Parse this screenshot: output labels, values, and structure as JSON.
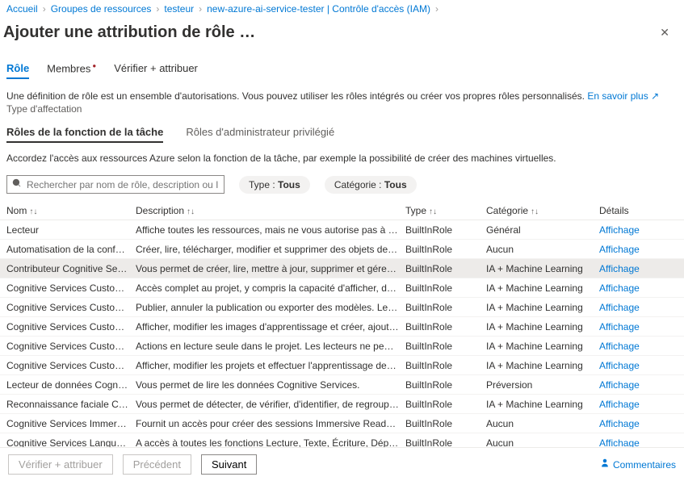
{
  "breadcrumb": [
    "Accueil",
    "Groupes de ressources",
    "testeur",
    "new-azure-ai-service-tester | Contrôle d'accès (IAM)"
  ],
  "page_title": "Ajouter une attribution de rôle",
  "title_dots": "…",
  "tabs": {
    "role": "Rôle",
    "members": "Membres",
    "review": "Vérifier + attribuer"
  },
  "definition_text": "Une définition de rôle est un ensemble d'autorisations. Vous pouvez utiliser les rôles intégrés ou créer vos propres rôles personnalisés.",
  "learn_more": "En savoir plus",
  "assignment_type_label": "Type d'affectation",
  "subtabs": {
    "job": "Rôles de la fonction de la tâche",
    "admin": "Rôles d'administrateur privilégié"
  },
  "subtab_help": "Accordez l'accès aux ressources Azure selon la fonction de la tâche, par exemple la possibilité de créer des machines virtuelles.",
  "search_placeholder": "Rechercher par nom de rôle, description ou ID",
  "filter_type": {
    "label": "Type : ",
    "value": "Tous"
  },
  "filter_cat": {
    "label": "Catégorie : ",
    "value": "Tous"
  },
  "columns": {
    "name": "Nom",
    "desc": "Description",
    "type": "Type",
    "cat": "Catégorie",
    "details": "Détails"
  },
  "view_label": "Affichage",
  "rows": [
    {
      "name": "Lecteur",
      "desc": "Affiche toutes les ressources, mais ne vous autorise pas à apporter des ch…",
      "type": "BuiltInRole",
      "cat": "Général"
    },
    {
      "name": "Automatisation de la confor…",
      "desc": "Créer, lire, télécharger, modifier et supprimer des objets de rapports et d'a…",
      "type": "BuiltInRole",
      "cat": "Aucun"
    },
    {
      "name": "Contributeur Cognitive Services",
      "desc": "Vous permet de créer, lire, mettre à jour, supprimer et gérer les clés de Co…",
      "type": "BuiltInRole",
      "cat": "IA + Machine Learning",
      "selected": true
    },
    {
      "name": "Cognitive Services Custom Vi…",
      "desc": "Accès complet au projet, y compris la capacité d'afficher, de créer, de mo…",
      "type": "BuiltInRole",
      "cat": "IA + Machine Learning"
    },
    {
      "name": "Cognitive Services Custom Vi…",
      "desc": "Publier, annuler la publication ou exporter des modèles. Le déploiement p…",
      "type": "BuiltInRole",
      "cat": "IA + Machine Learning"
    },
    {
      "name": "Cognitive Services Custom Vi…",
      "desc": "Afficher, modifier les images d'apprentissage et créer, ajouter ou suppri…",
      "type": "BuiltInRole",
      "cat": "IA + Machine Learning"
    },
    {
      "name": "Cognitive Services Custom Vi…",
      "desc": "Actions en lecture seule dans le projet. Les lecteurs ne peuvent pas crée…",
      "type": "BuiltInRole",
      "cat": "IA + Machine Learning"
    },
    {
      "name": "Cognitive Services Custom Vi…",
      "desc": "Afficher, modifier les projets et effectuer l'apprentissage des modèles, av…",
      "type": "BuiltInRole",
      "cat": "IA + Machine Learning"
    },
    {
      "name": "Lecteur de données Cognitive…",
      "desc": "Vous permet de lire les données Cognitive Services.",
      "type": "BuiltInRole",
      "cat": "Préversion"
    },
    {
      "name": "Reconnaissance faciale Cogn…",
      "desc": "Vous permet de détecter, de vérifier, d'identifier, de regrouper et de rech…",
      "type": "BuiltInRole",
      "cat": "IA + Machine Learning"
    },
    {
      "name": "Cognitive Services Immersive…",
      "desc": "Fournit un accès pour créer des sessions Immersive Reader et appeler de…",
      "type": "BuiltInRole",
      "cat": "Aucun"
    },
    {
      "name": "Cognitive Services Language …",
      "desc": "A accès à toutes les fonctions Lecture, Texte, Écriture, Déploiement et Sup…",
      "type": "BuiltInRole",
      "cat": "Aucun"
    }
  ],
  "footer": {
    "review": "Vérifier + attribuer",
    "prev": "Précédent",
    "next": "Suivant",
    "feedback": "Commentaires"
  }
}
